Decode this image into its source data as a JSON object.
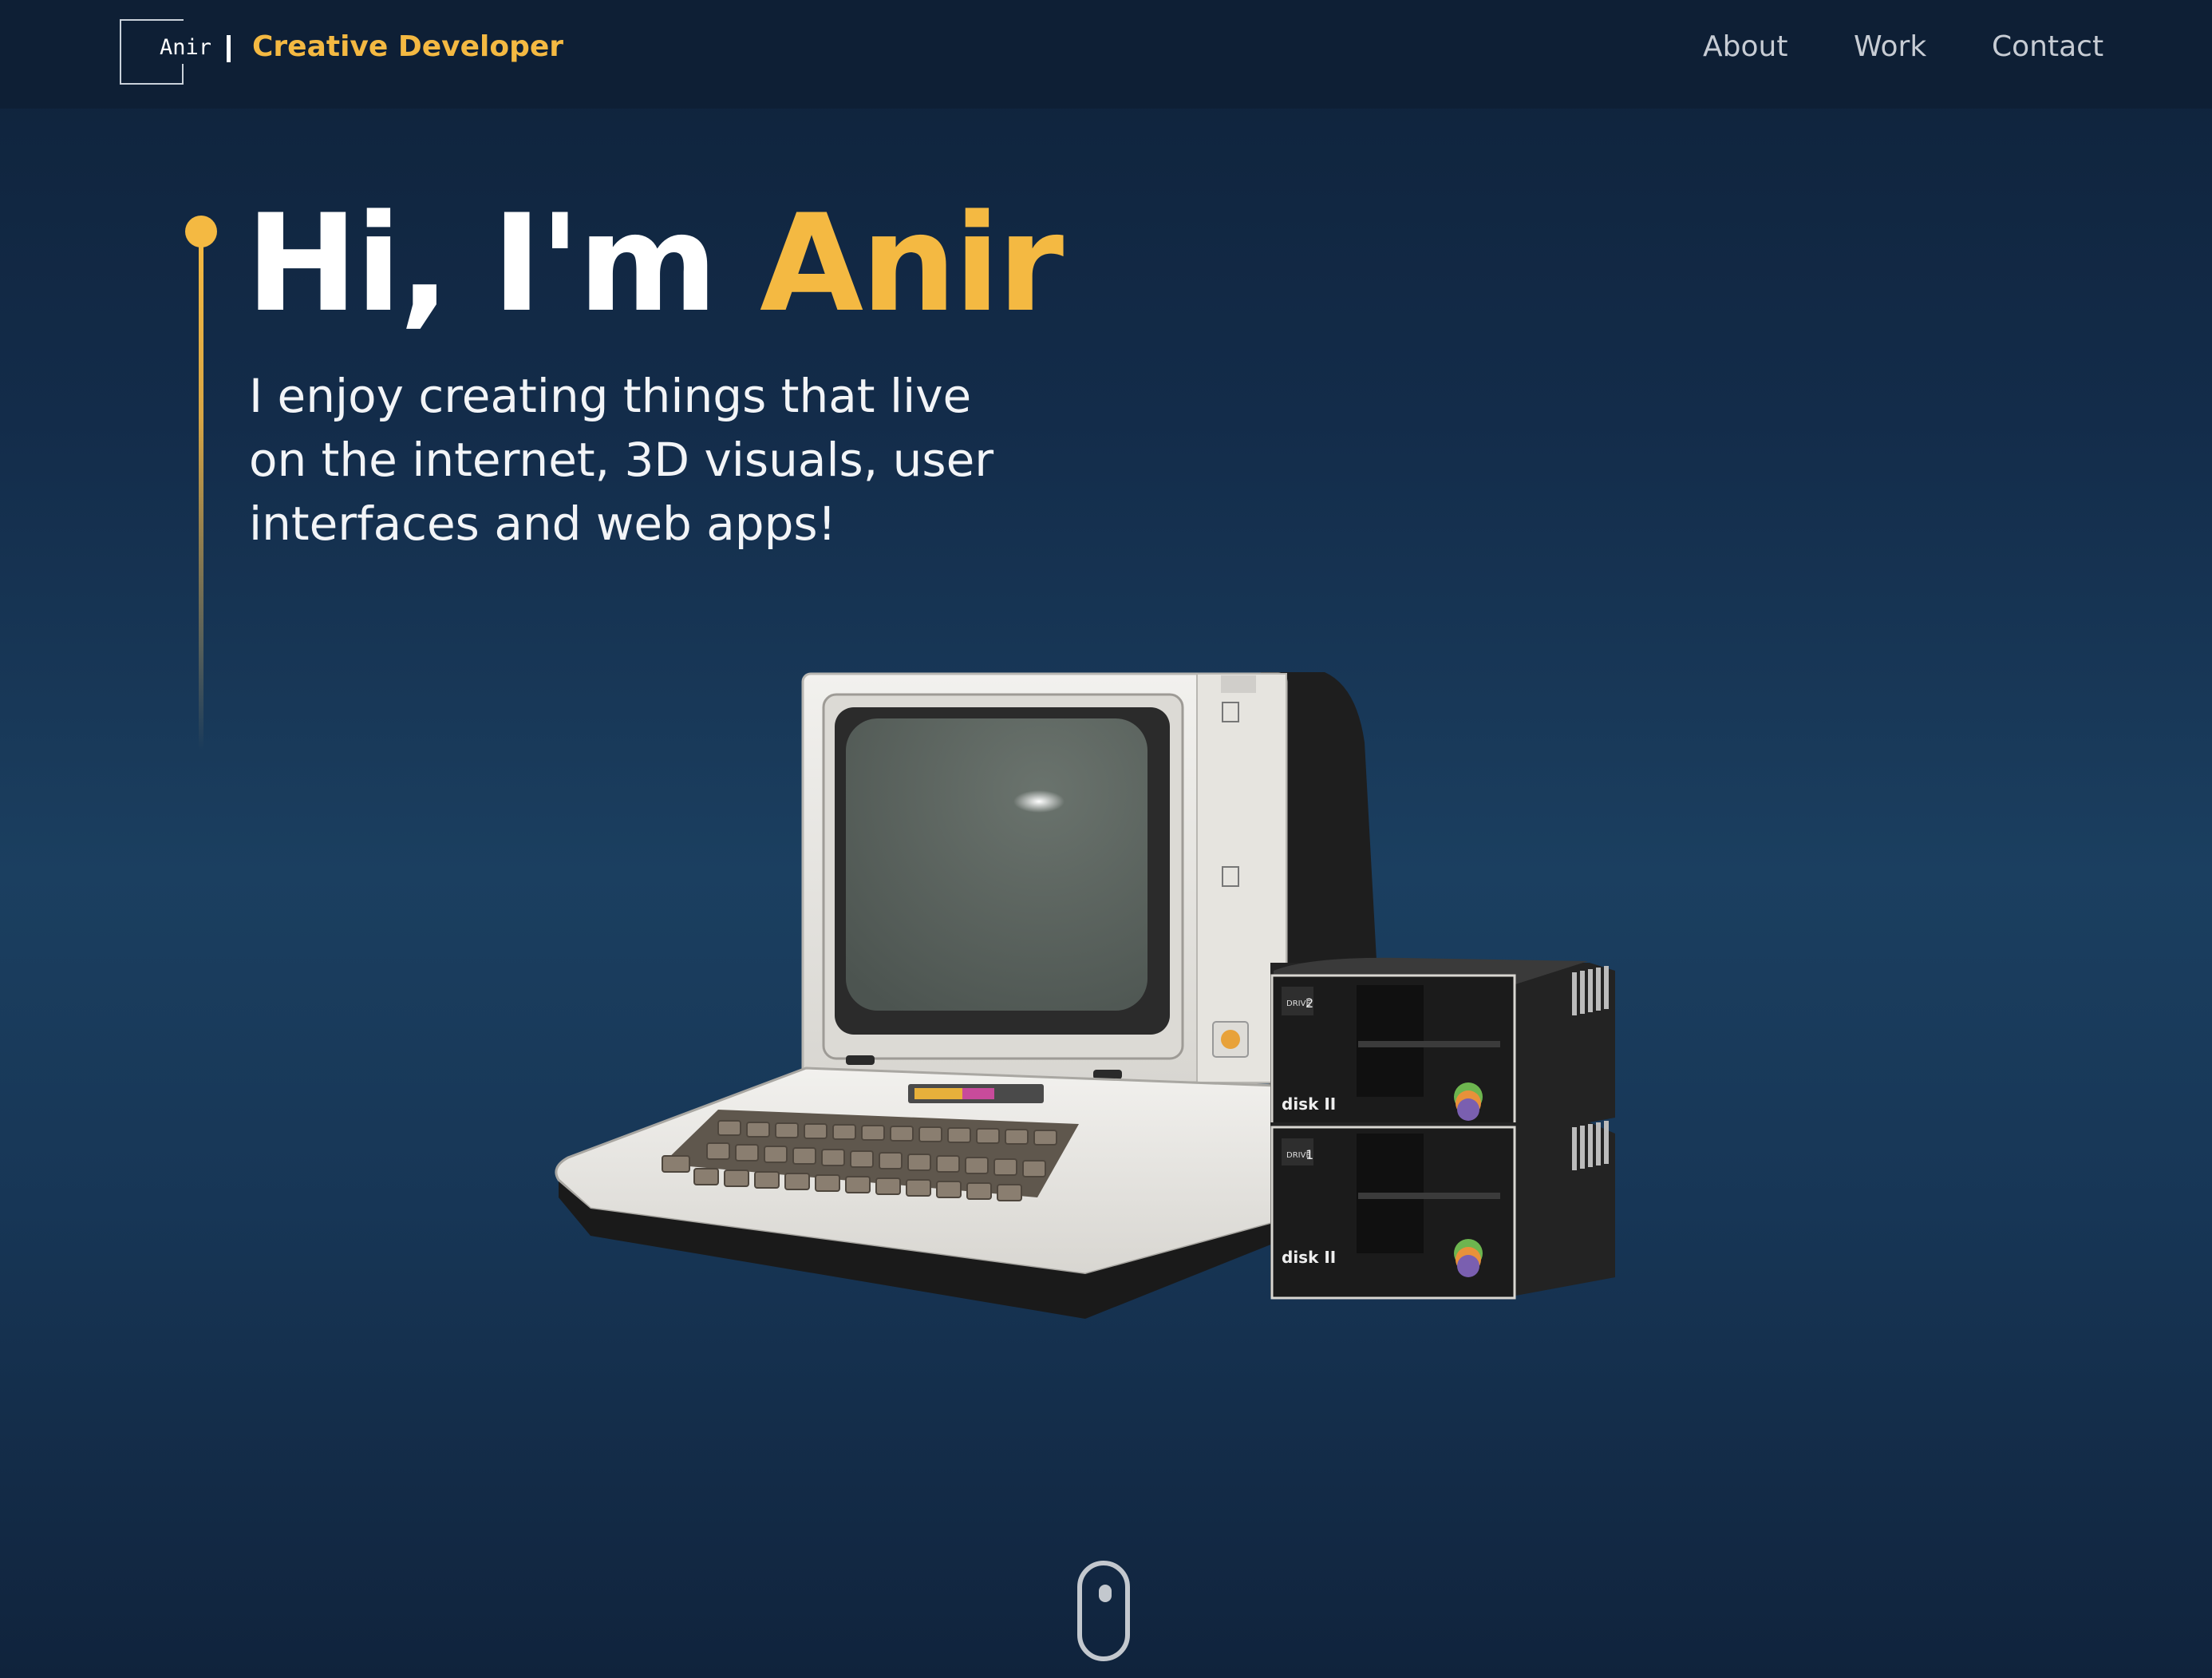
{
  "nav": {
    "logo_text": "Anir",
    "tagline": "Creative Developer",
    "links": [
      "About",
      "Work",
      "Contact"
    ]
  },
  "hero": {
    "greeting": "Hi, I'm",
    "name": "Anir",
    "subtitle": "I enjoy creating things that live on the internet, 3D visuals, user interfaces and web apps!"
  },
  "illustration": {
    "drive_top_number": "2",
    "drive_bottom_number": "1",
    "drive_label": "disk II",
    "drive_small_label": "DRIVE",
    "icons": [
      "apple-logo-icon",
      "scroll-mouse-icon"
    ]
  },
  "colors": {
    "accent": "#f4b942",
    "background_top": "#0f223a",
    "background_mid": "#1b3f60",
    "navbar": "#0e1f35",
    "nav_link": "#c7ccd4"
  }
}
